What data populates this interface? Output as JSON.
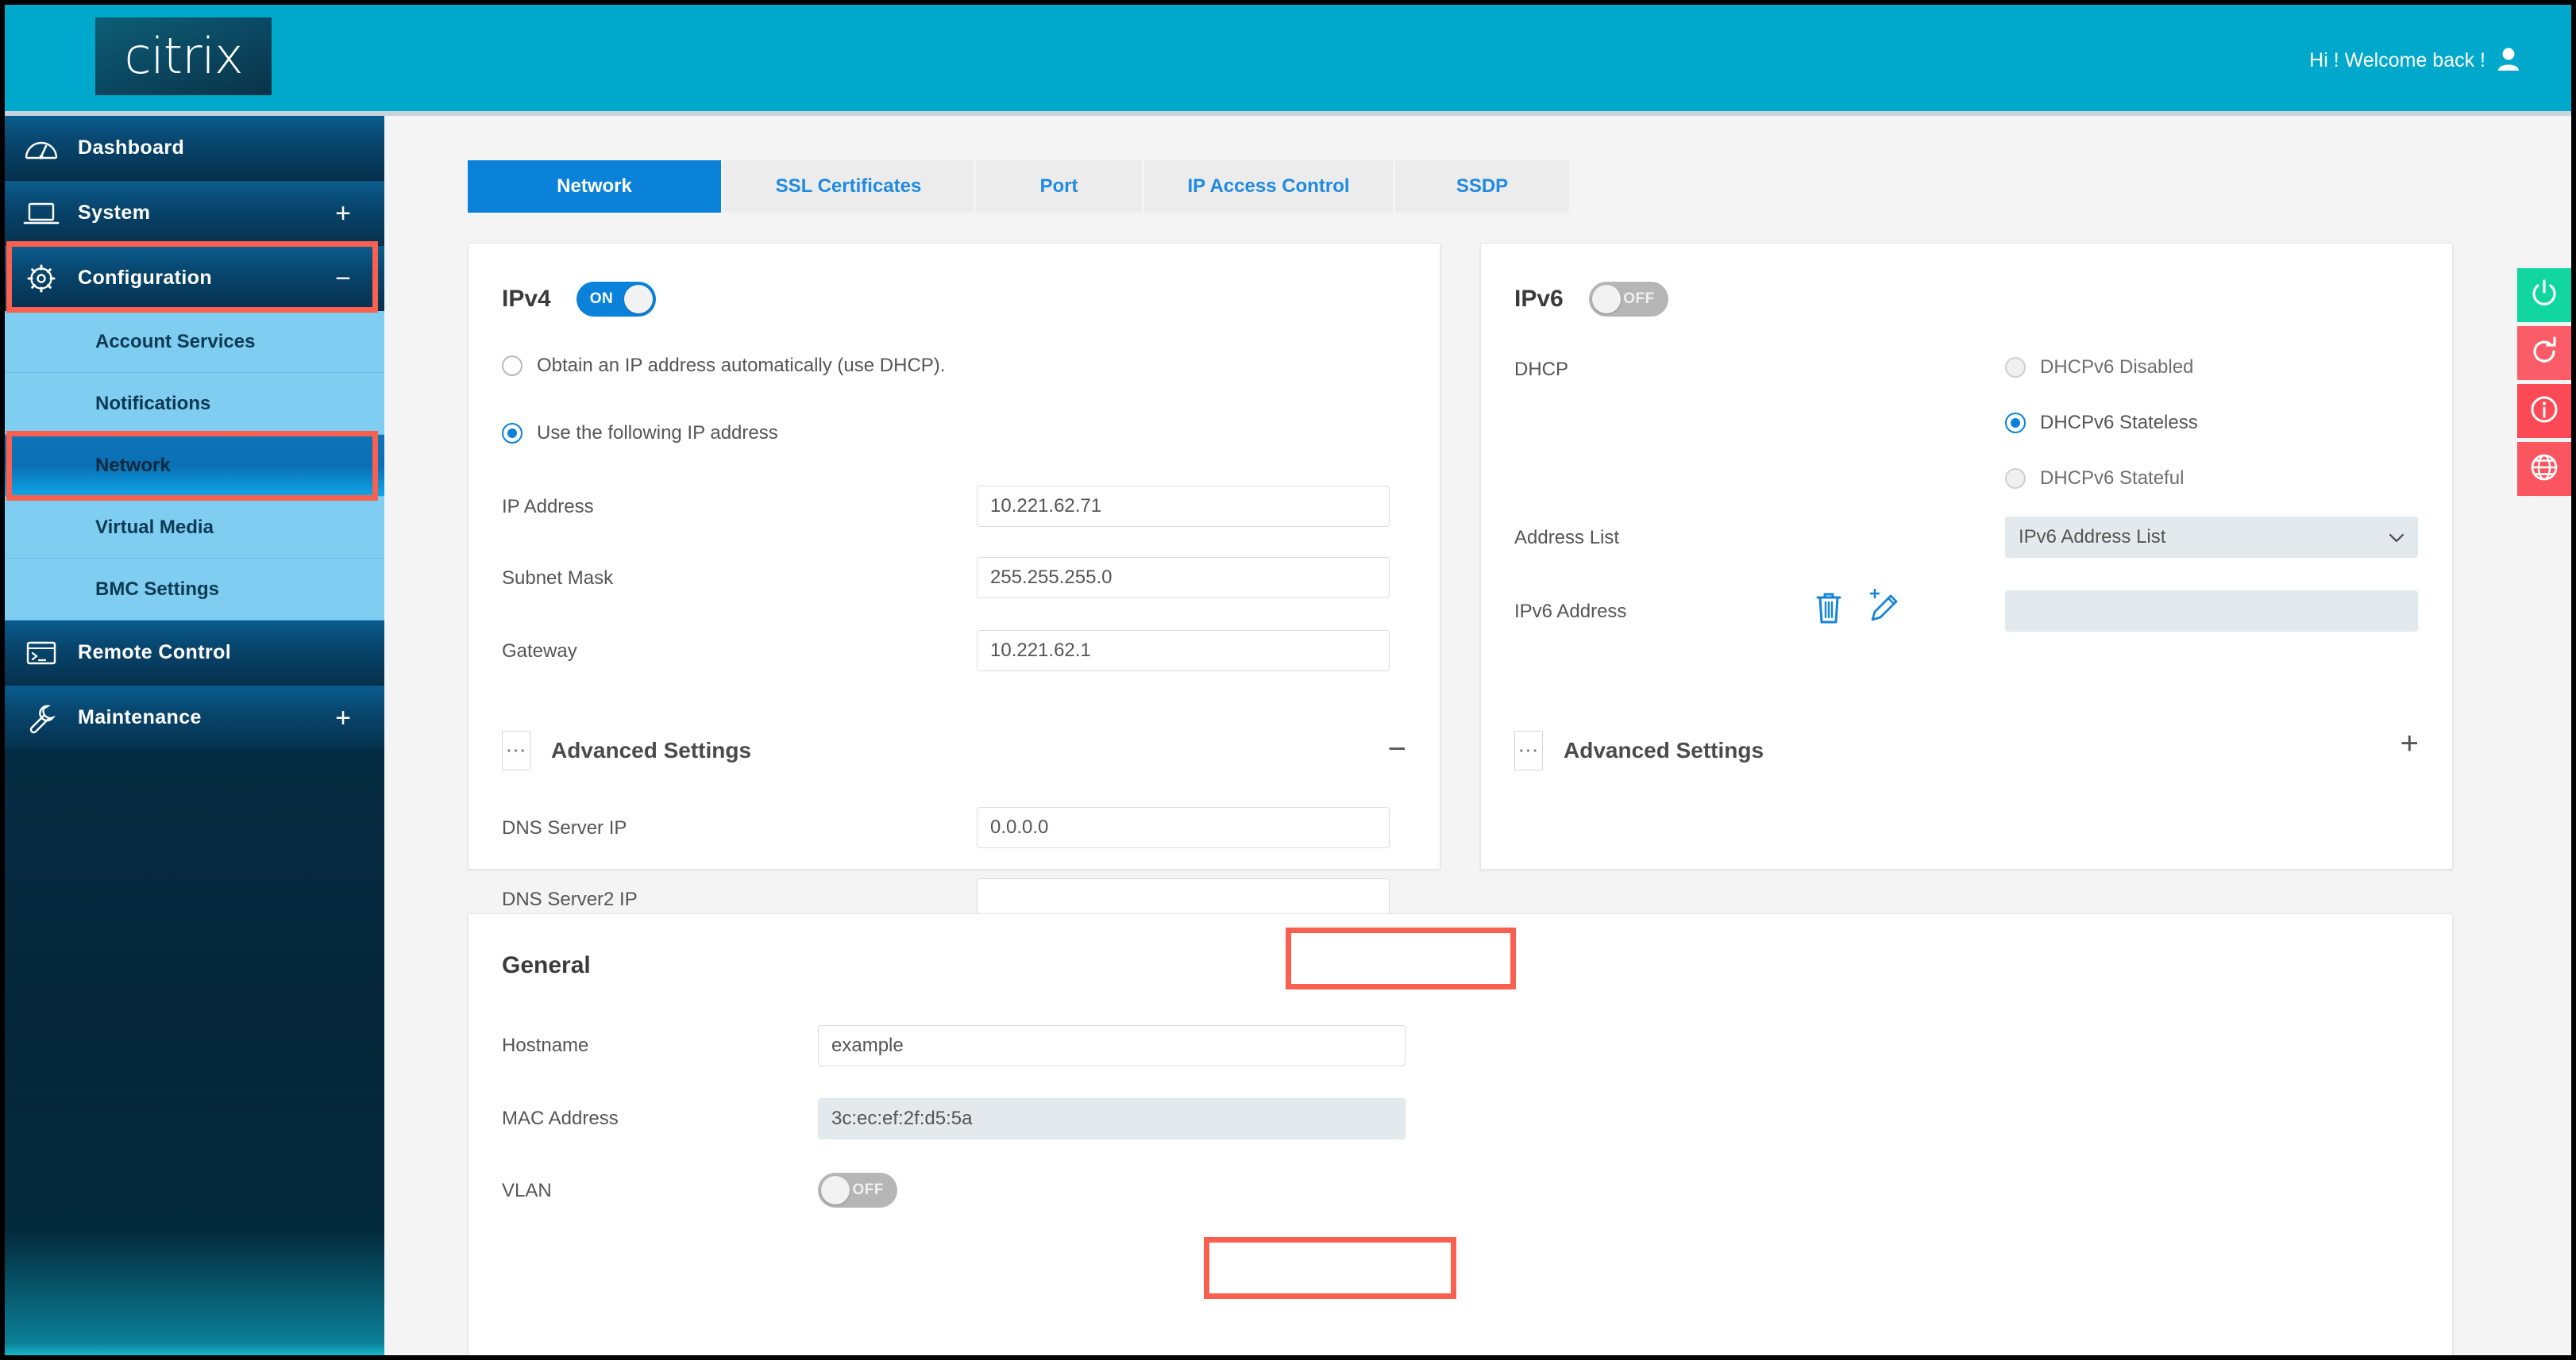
{
  "header": {
    "logo_text": "citrix",
    "welcome_text": "Hi ! Welcome back !",
    "avatar_icon": "user-avatar-icon"
  },
  "sidebar": {
    "items": [
      {
        "label": "Dashboard",
        "icon": "gauge-icon",
        "expand": "",
        "type": "top"
      },
      {
        "label": "System",
        "icon": "laptop-icon",
        "expand": "+",
        "type": "top"
      },
      {
        "label": "Configuration",
        "icon": "gear-icon",
        "expand": "−",
        "type": "top",
        "highlighted": true
      },
      {
        "label": "Account Services",
        "type": "sub"
      },
      {
        "label": "Notifications",
        "type": "sub"
      },
      {
        "label": "Network",
        "type": "sub",
        "active": true,
        "highlighted": true
      },
      {
        "label": "Virtual Media",
        "type": "sub"
      },
      {
        "label": "BMC Settings",
        "type": "sub"
      },
      {
        "label": "Remote Control",
        "icon": "terminal-icon",
        "expand": "",
        "type": "top"
      },
      {
        "label": "Maintenance",
        "icon": "wrench-icon",
        "expand": "+",
        "type": "top"
      }
    ]
  },
  "tabs": [
    {
      "label": "Network",
      "active": true
    },
    {
      "label": "SSL Certificates",
      "active": false
    },
    {
      "label": "Port",
      "active": false
    },
    {
      "label": "IP Access Control",
      "active": false
    },
    {
      "label": "SSDP",
      "active": false
    }
  ],
  "ipv4": {
    "title": "IPv4",
    "toggle_state": "ON",
    "radio_dhcp_label": "Obtain an IP address automatically (use DHCP).",
    "radio_static_label": "Use the following IP address",
    "selected_radio": "static",
    "fields": [
      {
        "label": "IP Address",
        "value": "10.221.62.71"
      },
      {
        "label": "Subnet Mask",
        "value": "255.255.255.0"
      },
      {
        "label": "Gateway",
        "value": "10.221.62.1"
      }
    ],
    "advanced": {
      "title": "Advanced Settings",
      "dots_icon": "ellipsis-icon",
      "collapse_symbol": "−",
      "expanded": true,
      "fields": [
        {
          "label": "DNS Server IP",
          "value": "0.0.0.0",
          "highlighted": true
        },
        {
          "label": "DNS Server2 IP",
          "value": ""
        }
      ]
    }
  },
  "ipv6": {
    "title": "IPv6",
    "toggle_state": "OFF",
    "dhcp_label": "DHCP",
    "dhcp_options": [
      {
        "label": "DHCPv6 Disabled",
        "selected": false
      },
      {
        "label": "DHCPv6 Stateless",
        "selected": true
      },
      {
        "label": "DHCPv6 Stateful",
        "selected": false
      }
    ],
    "address_list_label": "Address List",
    "address_list_value": "IPv6 Address List",
    "address_list_caret": "chevron-down-icon",
    "ipv6_address_label": "IPv6 Address",
    "ipv6_address_value": "",
    "delete_icon": "trash-icon",
    "edit_icon": "pencil-add-icon",
    "advanced": {
      "title": "Advanced Settings",
      "dots_icon": "ellipsis-icon",
      "collapse_symbol": "+",
      "expanded": false
    }
  },
  "general": {
    "title": "General",
    "hostname_label": "Hostname",
    "hostname_value": "example",
    "hostname_highlighted": true,
    "mac_label": "MAC Address",
    "mac_value": "3c:ec:ef:2f:d5:5a",
    "vlan_label": "VLAN",
    "vlan_state": "OFF"
  },
  "rail": [
    {
      "name": "power-icon",
      "color": "#12d6a0"
    },
    {
      "name": "restart-icon",
      "color": "#fb5d68"
    },
    {
      "name": "info-icon",
      "color": "#fb4a56"
    },
    {
      "name": "globe-icon",
      "color": "#fb5560"
    }
  ],
  "colors": {
    "header": "#00a8cc",
    "accent_blue": "#0b82da",
    "highlight_red": "#f9604f",
    "sidebar_sub": "#7fcdf0"
  }
}
